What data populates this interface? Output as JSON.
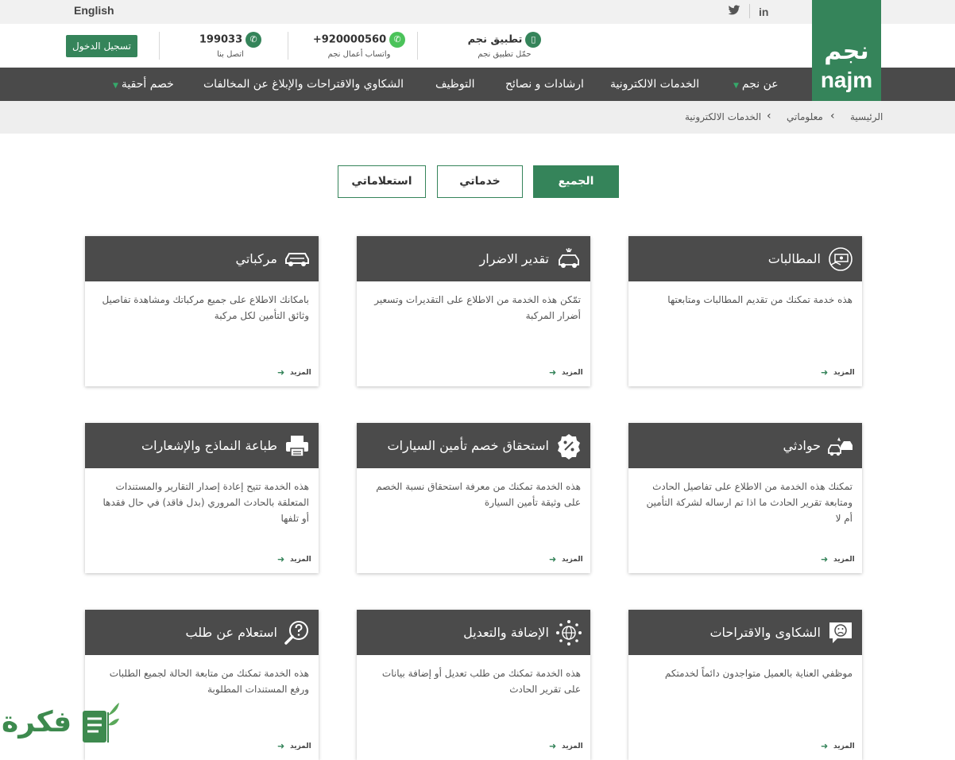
{
  "topbar": {
    "language_link": "English",
    "linkedin": "in",
    "twitter": "twitter"
  },
  "header": {
    "logo_ar": "نجم",
    "logo_en": "najm",
    "login_button": "تسجيل الدخول",
    "contacts": [
      {
        "main": "199033",
        "sub": "اتصل بنا",
        "icon": "phone-icon"
      },
      {
        "main": "+920000560",
        "sub": "واتساب أعمال نجم",
        "icon": "whatsapp-icon"
      },
      {
        "main": "تطبيق نجم",
        "sub": "حمّل تطبيق نجم",
        "icon": "mobile-icon"
      }
    ]
  },
  "nav": {
    "items": [
      {
        "label": "عن نجم",
        "has_dropdown": true
      },
      {
        "label": "الخدمات الالكترونية",
        "has_dropdown": false
      },
      {
        "label": "ارشادات و نصائح",
        "has_dropdown": false
      },
      {
        "label": "التوظيف",
        "has_dropdown": false
      },
      {
        "label": "الشكاوي والاقتراحات والإبلاغ عن المخالفات",
        "has_dropdown": false
      },
      {
        "label": "خصم أحقية",
        "has_dropdown": true
      }
    ]
  },
  "breadcrumb": [
    "الرئيسية",
    "معلوماتي",
    "الخدمات الالكترونية"
  ],
  "filters": {
    "all": "الجميع",
    "services": "خدماتي",
    "inquiries": "استعلاماتي"
  },
  "more_label": "المزيد",
  "cards": [
    {
      "title": "المطالبات",
      "icon": "money-claim-icon",
      "desc": "هذه خدمة تمكنك من تقديم المطالبات ومتابعتها"
    },
    {
      "title": "تقدير الاضرار",
      "icon": "damaged-car-icon",
      "desc": "تمّكن هذه الخدمة من الاطلاع على التقديرات وتسعير أضرار المركبة"
    },
    {
      "title": "مركباتي",
      "icon": "car-icon",
      "desc": "بامكانك الاطلاع على جميع مركباتك ومشاهدة تفاصيل وثائق التأمين لكل مركبة"
    },
    {
      "title": "حوادثي",
      "icon": "car-crash-icon",
      "desc": "تمكنك هذه الخدمة من الاطلاع على تفاصيل الحادث ومتابعة تقرير الحادث ما اذا تم ارساله لشركة التأمين أم لا"
    },
    {
      "title": "استحقاق خصم تأمين السيارات",
      "icon": "percent-badge-icon",
      "desc": "هذه الخدمة تمكنك من معرفة استحقاق نسبة الخصم على وثيقة تأمين السيارة"
    },
    {
      "title": "طباعة النماذج والإشعارات",
      "icon": "printer-icon",
      "desc": "هذه الخدمة تتيح إعادة إصدار التقارير والمستندات المتعلقة بالحادث المروري (بدل فاقد) في حال فقدها أو تلفها"
    },
    {
      "title": "الشكاوى والاقتراحات",
      "icon": "sad-face-chat-icon",
      "desc": "موظفي العناية بالعميل متواجدون دائماً لخدمتكم"
    },
    {
      "title": "الإضافة والتعديل",
      "icon": "network-globe-icon",
      "desc": "هذه الخدمة تمكنك من طلب تعديل أو إضافة بيانات على تقرير الحادث"
    },
    {
      "title": "استعلام عن طلب",
      "icon": "question-search-icon",
      "desc": "هذه الخدمة تمكنك من متابعة الحالة لجميع الطلبات ورفع المستندات المطلوبة"
    }
  ],
  "watermark": "فكرة"
}
